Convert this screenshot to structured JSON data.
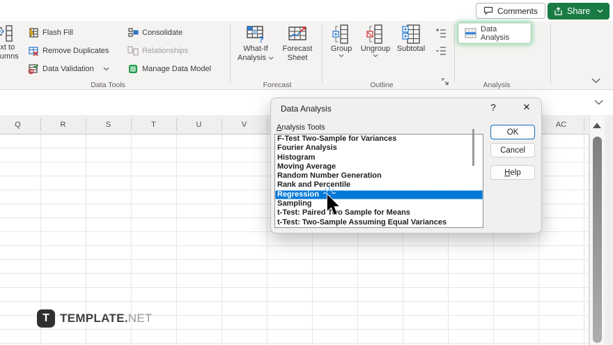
{
  "topbar": {
    "comments_label": "Comments",
    "share_label": "Share"
  },
  "ribbon": {
    "data_tools": {
      "label": "Data Tools",
      "text_to_columns_line1": "Text to",
      "text_to_columns_line2": "Columns",
      "flash_fill": "Flash Fill",
      "remove_duplicates": "Remove Duplicates",
      "data_validation": "Data Validation",
      "consolidate": "Consolidate",
      "relationships": "Relationships",
      "manage_data_model": "Manage Data Model"
    },
    "forecast": {
      "label": "Forecast",
      "what_if_line1": "What-If",
      "what_if_line2": "Analysis",
      "forecast_sheet_line1": "Forecast",
      "forecast_sheet_line2": "Sheet"
    },
    "outline": {
      "label": "Outline",
      "group": "Group",
      "ungroup": "Ungroup",
      "subtotal": "Subtotal"
    },
    "analysis": {
      "label": "Analysis",
      "data_analysis": "Data Analysis"
    }
  },
  "sheet": {
    "columns_left": [
      "Q",
      "R",
      "S",
      "T",
      "U",
      "V"
    ],
    "column_right": "AC"
  },
  "dialog": {
    "title": "Data Analysis",
    "help_glyph": "?",
    "close_glyph": "✕",
    "tools_label_first": "A",
    "tools_label_rest": "nalysis Tools",
    "items": [
      "F-Test Two-Sample for Variances",
      "Fourier Analysis",
      "Histogram",
      "Moving Average",
      "Random Number Generation",
      "Rank and Percentile",
      "Regression",
      "Sampling",
      "t-Test: Paired Two Sample for Means",
      "t-Test: Two-Sample Assuming Equal Variances"
    ],
    "selected_index": 6,
    "selected_item": "Regression",
    "ok": "OK",
    "cancel": "Cancel",
    "help_first": "H",
    "help_rest": "elp"
  },
  "watermark": {
    "badge_letter": "T",
    "brand_bold": "TEMPLATE.",
    "brand_light": "NET"
  },
  "colors": {
    "selection_blue": "#0078d7",
    "share_green": "#197b43",
    "highlight_glow": "#56c47e"
  }
}
